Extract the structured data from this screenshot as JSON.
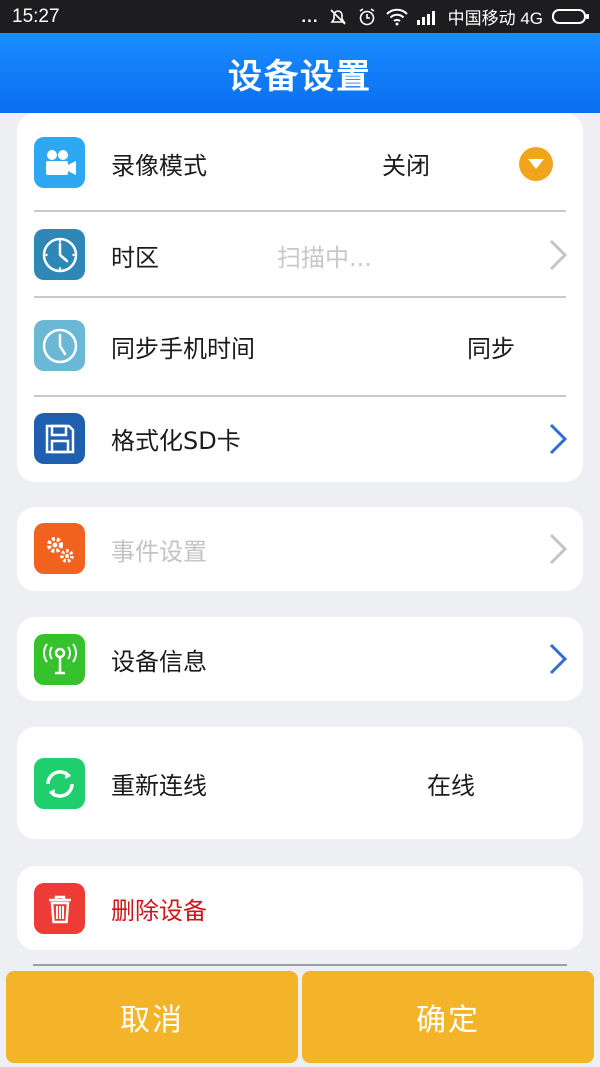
{
  "status_bar": {
    "time": "15:27",
    "dots": "...",
    "carrier": "中国移动 4G",
    "icons": [
      "notification-off-icon",
      "alarm-icon",
      "wifi-icon",
      "signal-icon",
      "battery-icon"
    ]
  },
  "header": {
    "title": "设备设置"
  },
  "settings": {
    "record_mode": {
      "label": "录像模式",
      "value": "关闭",
      "icon": "video-camera-icon",
      "icon_color": "#2fa8f2"
    },
    "timezone": {
      "label": "时区",
      "value": "扫描中...",
      "icon": "clock-icon",
      "icon_color": "#2f87b8"
    },
    "sync_time": {
      "label": "同步手机时间",
      "value": "同步",
      "icon": "clock-icon",
      "icon_color": "#6ab7d6"
    },
    "format_sd": {
      "label": "格式化SD卡",
      "icon": "floppy-disk-icon",
      "icon_color": "#1f5fb0"
    },
    "event_settings": {
      "label": "事件设置",
      "icon": "gears-icon",
      "icon_color": "#f2621f"
    },
    "device_info": {
      "label": "设备信息",
      "icon": "antenna-icon",
      "icon_color": "#35c22c"
    },
    "reconnect": {
      "label": "重新连线",
      "value": "在线",
      "icon": "refresh-icon",
      "icon_color": "#1fcf6e"
    },
    "delete_device": {
      "label": "删除设备",
      "icon": "trash-icon",
      "icon_color": "#ef3b36",
      "label_color": "#d0161b"
    }
  },
  "buttons": {
    "cancel": "取消",
    "confirm": "确定"
  },
  "colors": {
    "accent": "#1a8cff",
    "button": "#f3b42a",
    "dropdown": "#f0a51c",
    "arrow_active": "#2f6fd0",
    "arrow_disabled": "#c5c5c8"
  }
}
